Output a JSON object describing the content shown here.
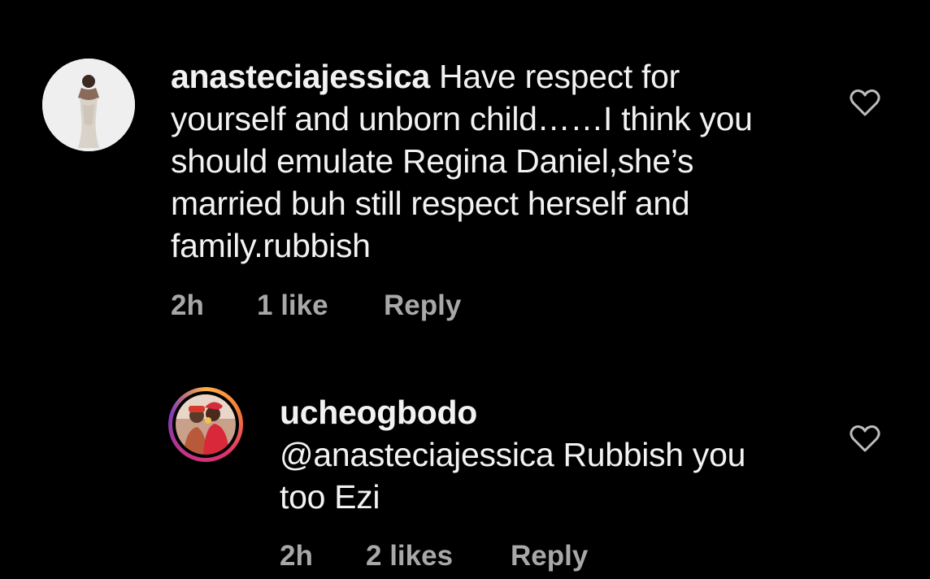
{
  "comments": [
    {
      "username": "anasteciajessica",
      "text": " Have respect for yourself and unborn child……I think you should emulate Regina Daniel,she’s married buh still respect herself and family.rubbish",
      "lines": [
        " Have respect for",
        "yourself and unborn child……I think you",
        "should emulate Regina Daniel,she’s",
        "married buh still respect herself and",
        "family.rubbish"
      ],
      "time": "2h",
      "likes": "1 like",
      "reply_label": "Reply",
      "avatar_icon": "profile-photo-woman-white-dress",
      "like_icon": "heart-outline-icon"
    },
    {
      "username": "ucheogbodo",
      "lines": [
        "@anasteciajessica Rubbish you",
        "too Ezi"
      ],
      "time": "2h",
      "likes": "2 likes",
      "reply_label": "Reply",
      "avatar_icon": "profile-photo-couple-story-ring",
      "like_icon": "heart-outline-icon"
    }
  ],
  "colors": {
    "background": "#000000",
    "text": "#f2f2f2",
    "meta": "#a8a8a8",
    "story_ring": [
      "#fcaf45",
      "#e1306c",
      "#833ab4"
    ]
  }
}
